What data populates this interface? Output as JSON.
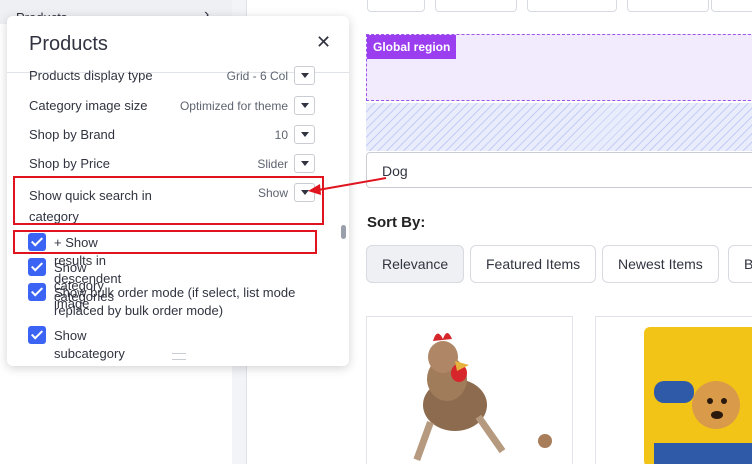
{
  "sidebar": {
    "top_item": "Products"
  },
  "panel": {
    "title": "Products",
    "settings": [
      {
        "label": "Products display type",
        "value": "Grid - 6 Col"
      },
      {
        "label": "Category image size",
        "value": "Optimized for theme"
      },
      {
        "label": "Shop by Brand",
        "value": "10"
      },
      {
        "label": "Shop by Price",
        "value": "Slider"
      },
      {
        "label": "Show quick search in category",
        "value": "Show"
      }
    ],
    "checkboxes": [
      {
        "label": "+ Show results in descendent categories",
        "checked": true
      },
      {
        "label": "Show category image",
        "checked": true
      },
      {
        "label": "Show bulk order mode (if select, list mode replaced by bulk order mode)",
        "checked": true
      },
      {
        "label": "Show subcategory thumbnails",
        "checked": true
      }
    ]
  },
  "preview": {
    "global_region": "Global region",
    "search_value": "Dog",
    "sort_by": "Sort By:",
    "sort_options": [
      "Relevance",
      "Featured Items",
      "Newest Items",
      "B"
    ],
    "active_sort": "Relevance"
  },
  "colors": {
    "accent": "#3c64f4",
    "global_region_tag": "#9b3ef0",
    "annotation": "#e0141e"
  }
}
